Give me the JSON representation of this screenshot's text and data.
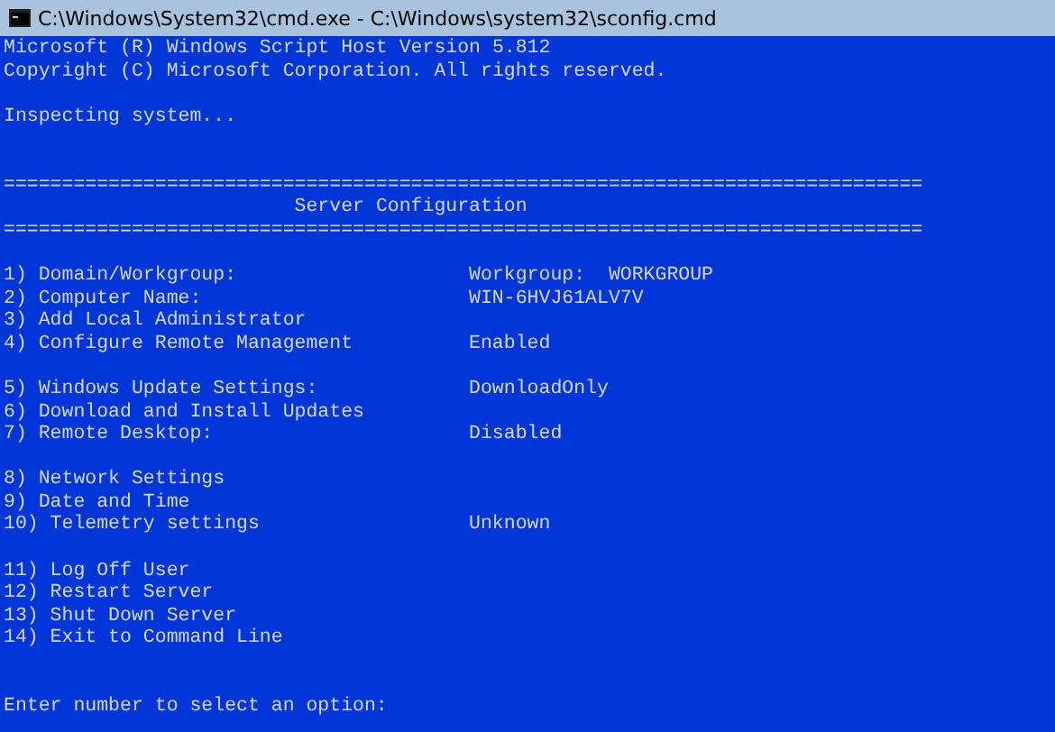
{
  "window": {
    "title": "C:\\Windows\\System32\\cmd.exe - C:\\Windows\\system32\\sconfig.cmd"
  },
  "intro_lines": [
    "Microsoft (R) Windows Script Host Version 5.812",
    "Copyright (C) Microsoft Corporation. All rights reserved."
  ],
  "status_line": "Inspecting system...",
  "banner": {
    "rule_top": "===============================================================================",
    "title": "Server Configuration",
    "rule_bottom": "==============================================================================="
  },
  "menu_groups": [
    {
      "items": [
        {
          "label": "1) Domain/Workgroup:",
          "value": "Workgroup:  WORKGROUP"
        },
        {
          "label": "2) Computer Name:",
          "value": "WIN-6HVJ61ALV7V"
        },
        {
          "label": "3) Add Local Administrator"
        },
        {
          "label": "4) Configure Remote Management",
          "value": "Enabled"
        }
      ]
    },
    {
      "items": [
        {
          "label": "5) Windows Update Settings:",
          "value": "DownloadOnly"
        },
        {
          "label": "6) Download and Install Updates"
        },
        {
          "label": "7) Remote Desktop:",
          "value": "Disabled"
        }
      ]
    },
    {
      "items": [
        {
          "label": "8) Network Settings"
        },
        {
          "label": "9) Date and Time"
        },
        {
          "label": "10) Telemetry settings",
          "value": "Unknown"
        }
      ]
    },
    {
      "items": [
        {
          "label": "11) Log Off User"
        },
        {
          "label": "12) Restart Server"
        },
        {
          "label": "13) Shut Down Server"
        },
        {
          "label": "14) Exit to Command Line"
        }
      ]
    }
  ],
  "prompt": "Enter number to select an option:"
}
